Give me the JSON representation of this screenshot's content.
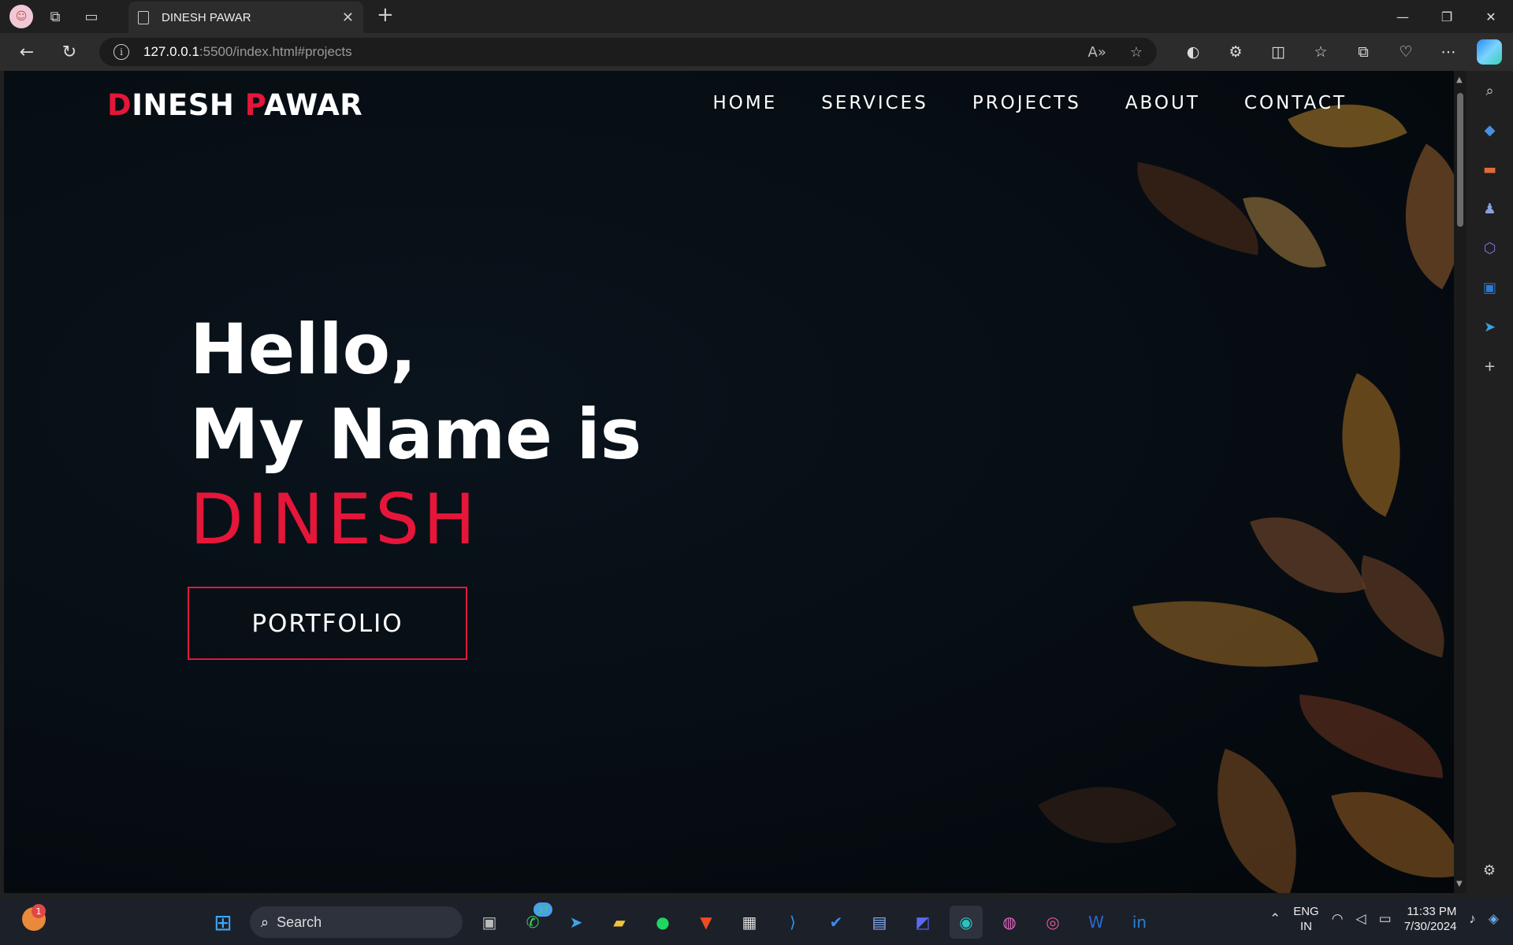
{
  "browser": {
    "tab_title": "DINESH PAWAR",
    "url_host": "127.0.0.1",
    "url_rest": ":5500/index.html#projects"
  },
  "site": {
    "logo": {
      "first_initial": "D",
      "first_rest": "INESH ",
      "last_initial": "P",
      "last_rest": "AWAR"
    },
    "menu": [
      "HOME",
      "SERVICES",
      "PROJECTS",
      "ABOUT",
      "CONTACT"
    ],
    "hero": {
      "line1": "Hello,",
      "line2": "My Name is",
      "name": "DINESH"
    },
    "cta": "PORTFOLIO",
    "accent_color": "#e5163a"
  },
  "taskbar": {
    "search_label": "Search",
    "weather_badge": "1",
    "whatsapp_badge": "37",
    "lang_line1": "ENG",
    "lang_line2": "IN",
    "time": "11:33 PM",
    "date": "7/30/2024"
  }
}
